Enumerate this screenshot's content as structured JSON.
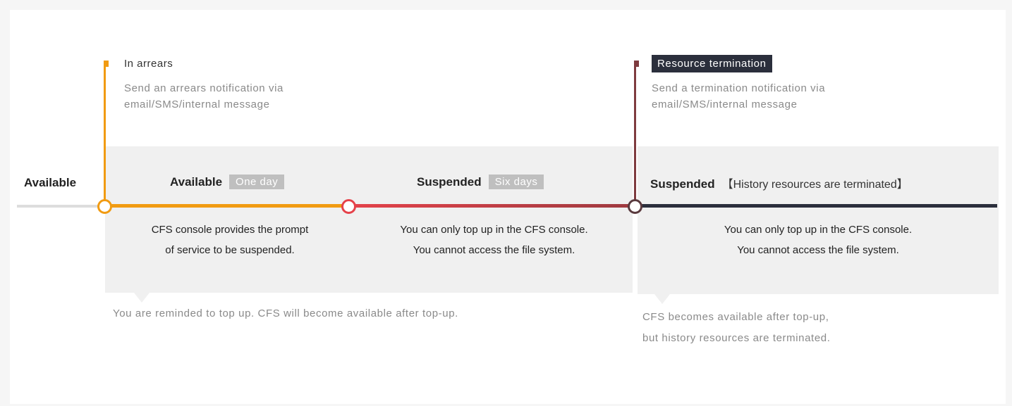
{
  "start_label": "Available",
  "events": [
    {
      "title": "In arrears",
      "description_lines": [
        "Send an arrears notification via",
        "email/SMS/internal message"
      ],
      "color": "#f19b12"
    },
    {
      "title": "Resource termination",
      "description_lines": [
        "Send a termination notification via",
        "email/SMS/internal message"
      ],
      "color": "#7e3b3f"
    }
  ],
  "phases": [
    {
      "name": "Available",
      "badge": "One day",
      "description_lines": [
        "CFS console provides the prompt",
        "of service to be suspended."
      ],
      "line_color": "#f19b12"
    },
    {
      "name": "Suspended",
      "badge": "Six days",
      "description_lines": [
        "You can only top up in the CFS console.",
        "You cannot access the file system."
      ],
      "line_color": "#e5424a"
    },
    {
      "name": "Suspended",
      "bracket_note": "【History resources are terminated】",
      "description_lines": [
        "You can only top up in the CFS console.",
        "You cannot access the file system."
      ],
      "line_color": "#2b2f3c"
    }
  ],
  "notes": [
    {
      "lines": [
        "You are reminded to top up. CFS will become available after top-up."
      ]
    },
    {
      "lines": [
        "CFS becomes available after top-up,",
        "but history resources are terminated."
      ]
    }
  ],
  "colors": {
    "initial_line": "#dddddd",
    "panel": "#f0f0f0",
    "node_orange": "#f19b12",
    "node_red": "#e5424a",
    "node_dark": "#5a3a3e"
  }
}
